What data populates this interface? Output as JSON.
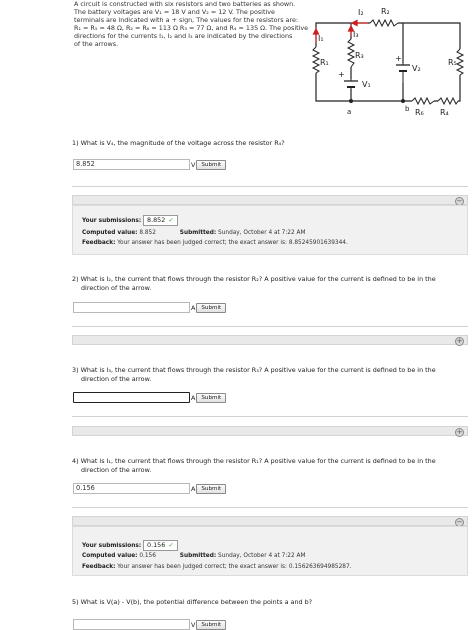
{
  "intro": {
    "lines": [
      "A circuit is constructed with six resistors and two batteries as shown.",
      "The battery voltages are V₁ = 18 V and V₂ = 12 V. The positive",
      "terminals are indicated with a + sign, The values for the resistors are:",
      "R₁ = R₅ = 48 Ω, R₂ = R₆ = 113 Ω R₃ = 77 Ω, and R₄ = 135 Ω. The positive",
      "directions for the currents I₁, I₂ and I₃ are indicated by the directions",
      "of the arrows."
    ]
  },
  "circuit": {
    "labels": {
      "I1": "I₁",
      "I2": "I₂",
      "I3": "I₃",
      "R1": "R₁",
      "R2": "R₂",
      "R3": "R₃",
      "R4": "R₄",
      "R5": "R₅",
      "R6": "R₆",
      "V1": "V₁",
      "V2": "V₂",
      "a": "a",
      "b": "b",
      "plus": "+"
    }
  },
  "q1": {
    "text": "1) What is V₄, the magnitude of the voltage across the resistor R₄?",
    "value": "8.852",
    "unit": "V",
    "submit": "Submit"
  },
  "q1_submission": {
    "your_label": "Your submissions:",
    "value": "8.852",
    "check": "✓",
    "computed_label": "Computed value:",
    "computed_value": "8.852",
    "submitted_label": "Submitted:",
    "submitted_value": "Sunday, October 4 at 7:22 AM",
    "feedback_label": "Feedback:",
    "feedback_value": "Your answer has been judged correct; the exact answer is: 8.85245901639344."
  },
  "q2": {
    "line1": "2) What is I₂, the current that flows through the resistor R₂? A positive value for the current is defined to be in the",
    "line2": "direction of the arrow.",
    "value": "",
    "unit": "A",
    "submit": "Submit"
  },
  "q3": {
    "line1": "3) What is I₃, the current that flows through the resistor R₃? A positive value for the current is defined to be in the",
    "line2": "direction of the arrow.",
    "value": "",
    "unit": "A",
    "submit": "Submit"
  },
  "q4": {
    "line1": "4) What is I₁, the current that flows through the resistor R₁? A positive value for the current is defined to be in the",
    "line2": "direction of the arrow.",
    "value": "0.156",
    "unit": "A",
    "submit": "Submit"
  },
  "q4_submission": {
    "your_label": "Your submissions:",
    "value": "0.156",
    "check": "✓",
    "computed_label": "Computed value:",
    "computed_value": "0.156",
    "submitted_label": "Submitted:",
    "submitted_value": "Sunday, October 4 at 7:22 AM",
    "feedback_label": "Feedback:",
    "feedback_value": "Your answer has been judged correct; the exact answer is: 0.156263694985287."
  },
  "q5": {
    "text": "5) What is V(a) - V(b), the potential difference between the points a and b?",
    "value": "",
    "unit": "V",
    "submit": "Submit"
  },
  "toggles": {
    "collapse": "−",
    "expand": "+"
  },
  "colors": {
    "arrow": "#cc1f1f",
    "panel": "#e9e9e9",
    "correct": "#3fa63f"
  }
}
